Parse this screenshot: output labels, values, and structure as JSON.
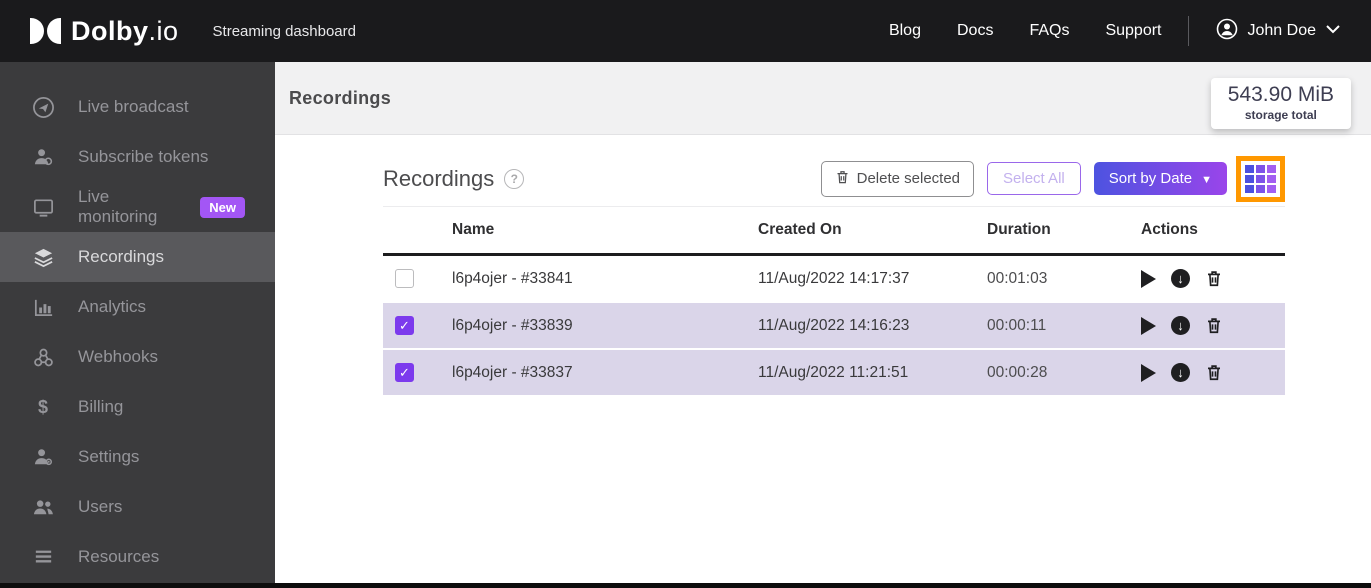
{
  "topnav": {
    "brand_bold": "Dolby",
    "brand_thin": ".io",
    "subtitle": "Streaming dashboard",
    "links": [
      "Blog",
      "Docs",
      "FAQs",
      "Support"
    ],
    "user_name": "John Doe",
    "user_caret": "⌄"
  },
  "sidebar": {
    "items": [
      {
        "label": "Live broadcast",
        "icon": "broadcast-icon"
      },
      {
        "label": "Subscribe tokens",
        "icon": "person-badge-icon"
      },
      {
        "label": "Live monitoring",
        "icon": "monitor-icon",
        "badge": "New"
      },
      {
        "label": "Recordings",
        "icon": "layers-icon",
        "selected": true
      },
      {
        "label": "Analytics",
        "icon": "bar-chart-icon"
      },
      {
        "label": "Webhooks",
        "icon": "webhook-icon"
      },
      {
        "label": "Billing",
        "icon": "dollar-icon",
        "glyph": "$"
      },
      {
        "label": "Settings",
        "icon": "person-gear-icon"
      },
      {
        "label": "Users",
        "icon": "users-icon"
      },
      {
        "label": "Resources",
        "icon": "list-icon"
      }
    ]
  },
  "header": {
    "title": "Recordings",
    "storage_value": "543.90 MiB",
    "storage_label": "storage total"
  },
  "toolbar": {
    "title": "Recordings",
    "help_glyph": "?",
    "delete_label": "Delete selected",
    "select_all_label": "Select All",
    "sort_label": "Sort by Date",
    "sort_caret": "▼"
  },
  "table": {
    "columns": [
      "Name",
      "Created On",
      "Duration",
      "Actions"
    ],
    "rows": [
      {
        "checked": false,
        "name": "l6p4ojer - #33841",
        "created": "11/Aug/2022 14:17:37",
        "duration": "00:01:03"
      },
      {
        "checked": true,
        "name": "l6p4ojer - #33839",
        "created": "11/Aug/2022 14:16:23",
        "duration": "00:00:11"
      },
      {
        "checked": true,
        "name": "l6p4ojer - #33837",
        "created": "11/Aug/2022 11:21:51",
        "duration": "00:00:28"
      }
    ],
    "row_action_icons": [
      "play-icon",
      "download-icon",
      "trash-icon"
    ]
  },
  "colors": {
    "navbar_bg": "#1a1a1c",
    "sidebar_bg": "#3b3b3d",
    "sidebar_selected_bg": "#59595c",
    "accent_purple": "#a356f5",
    "checkbox_purple": "#7c3aed",
    "sort_gradient_start": "#4d53e0",
    "sort_gradient_end": "#9a45ea",
    "selected_row_bg": "#dad5e9",
    "highlight_orange": "#ff9800",
    "header_band_bg": "#f1f1f2"
  }
}
